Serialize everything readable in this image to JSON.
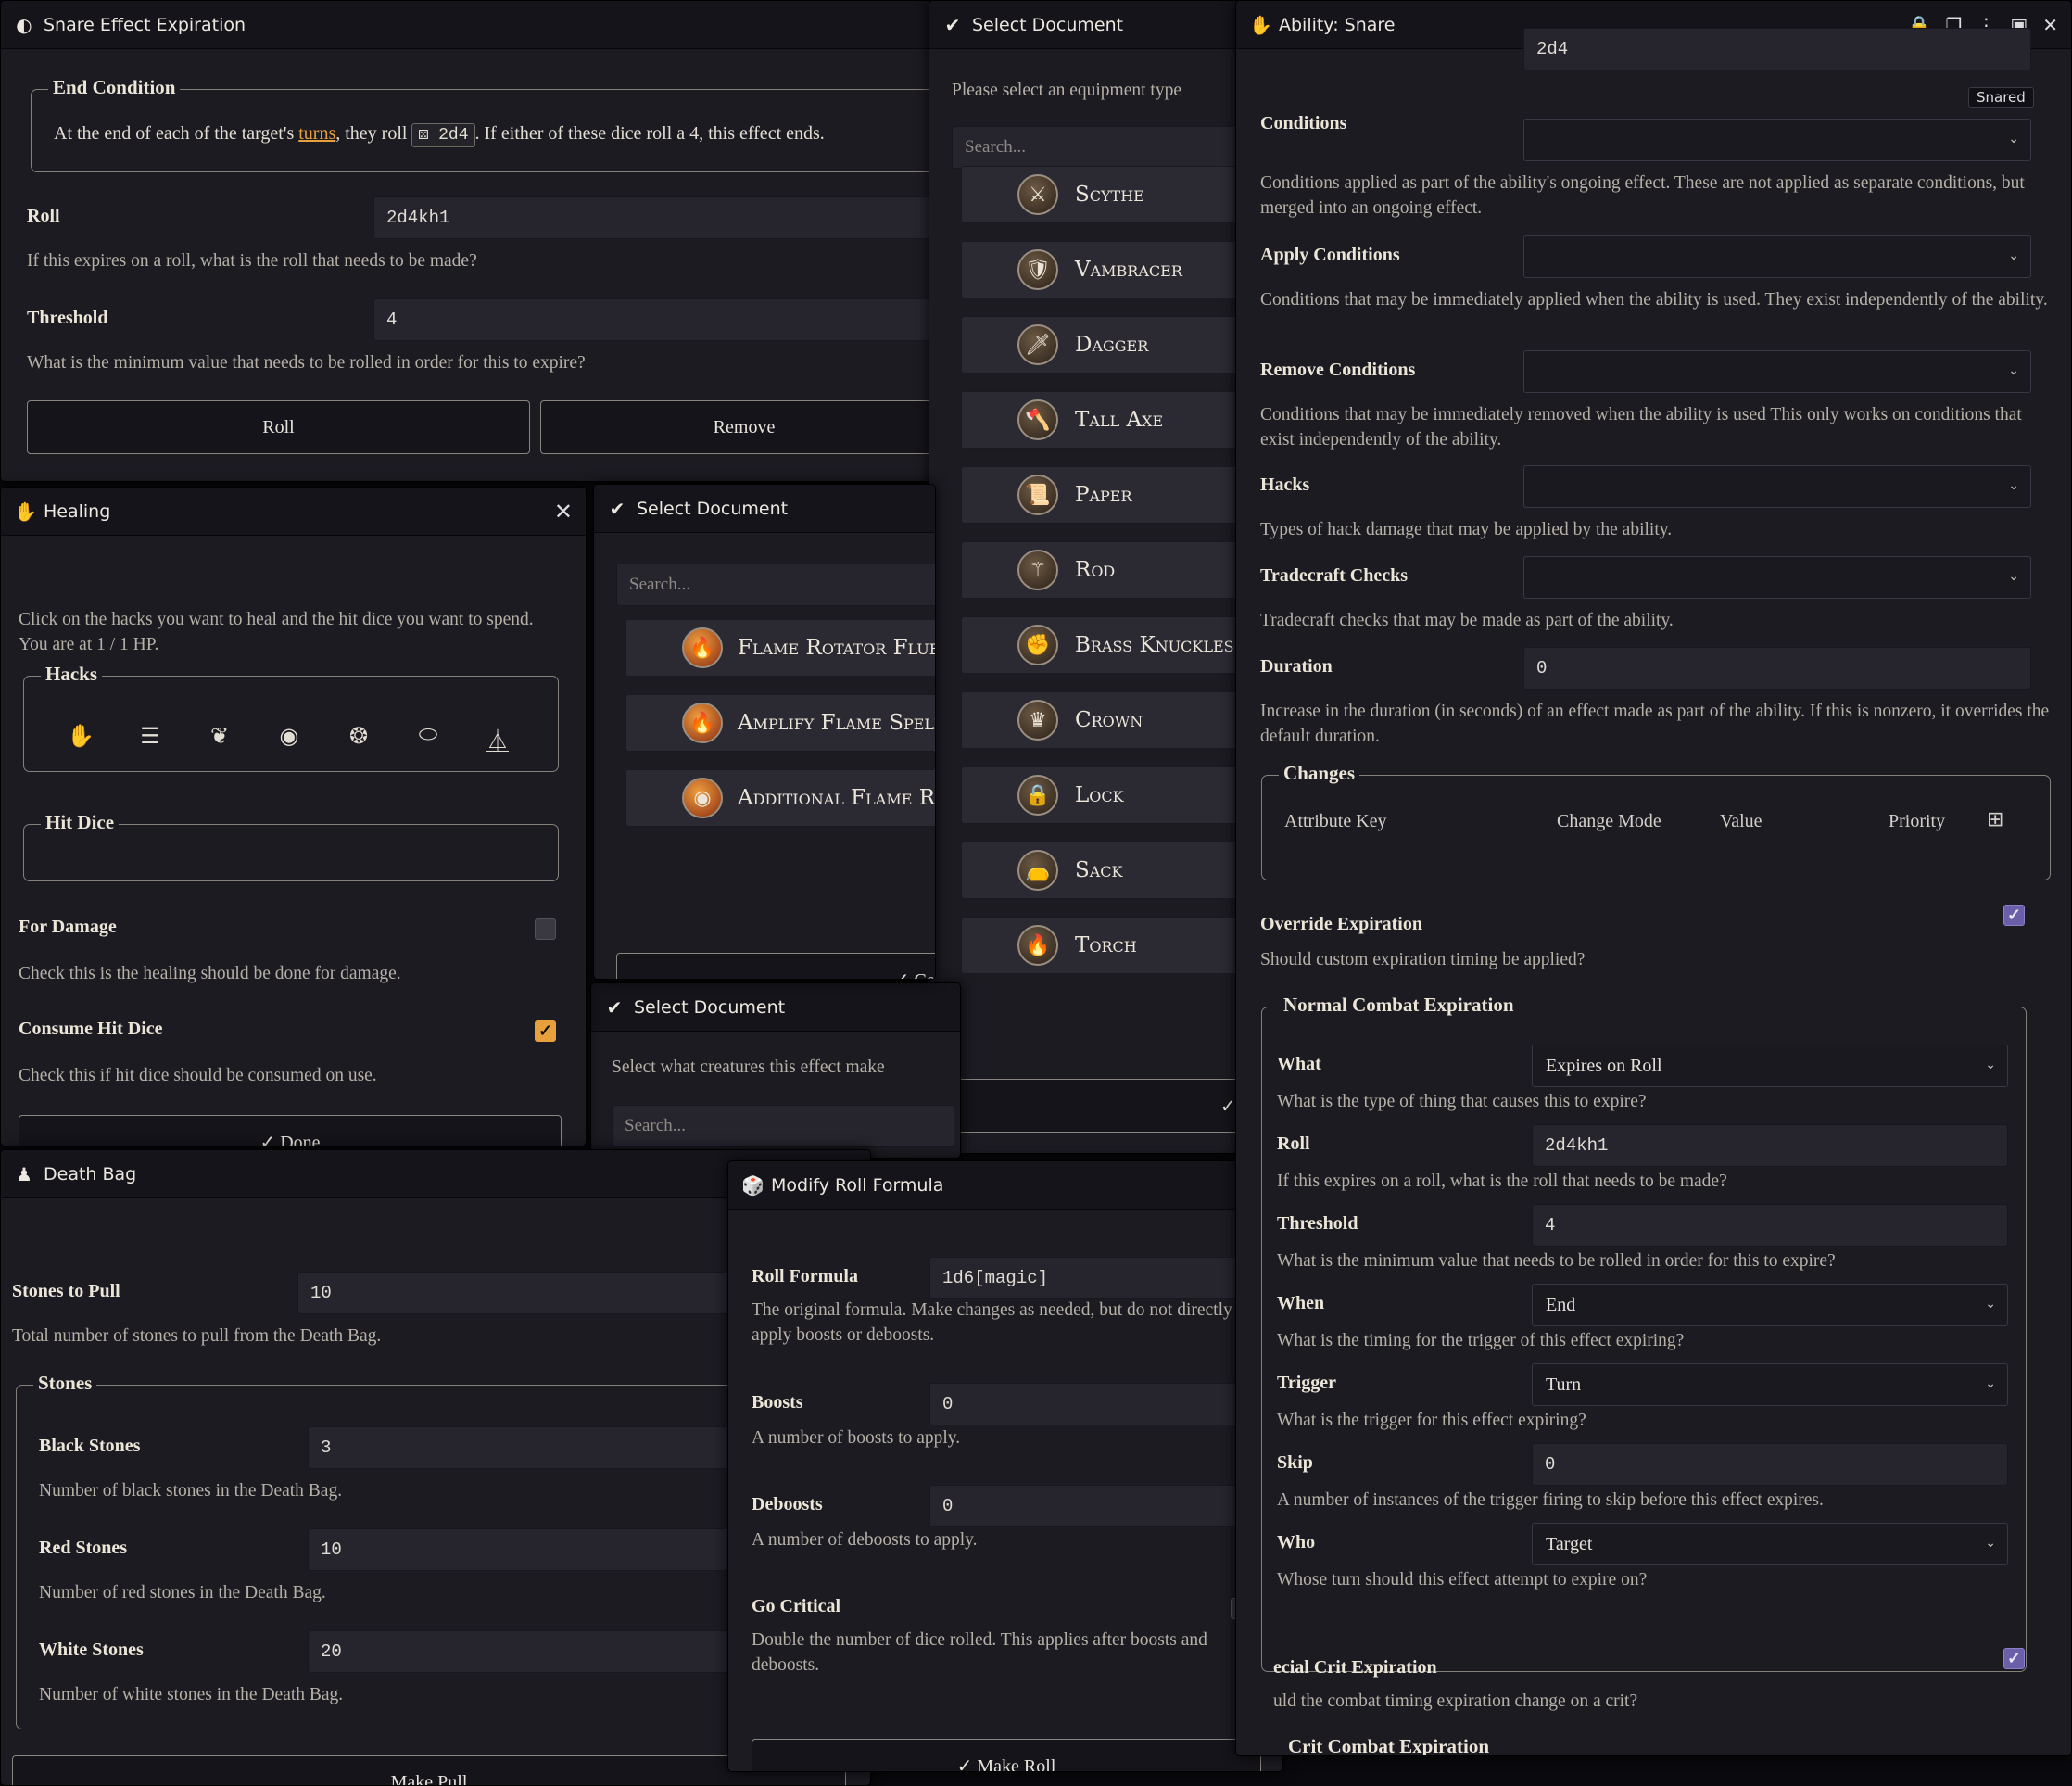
{
  "snare_win": {
    "title": "Snare Effect Expiration",
    "end_condition_legend": "End Condition",
    "end_text_pre": "At the end of each of the target's ",
    "end_text_link": "turns",
    "end_text_mid": ", they roll ",
    "end_text_dice": "2d4",
    "end_text_post": ". If either of these dice roll a 4, this effect ends.",
    "roll_label": "Roll",
    "roll_value": "2d4kh1",
    "roll_hint": "If this expires on a roll, what is the roll that needs to be made?",
    "threshold_label": "Threshold",
    "threshold_value": "4",
    "threshold_hint": "What is the minimum value that needs to be rolled in order for this to expire?",
    "roll_button": "Roll",
    "remove_button": "Remove"
  },
  "healing_win": {
    "title": "Healing",
    "intro": "Click on the hacks you want to heal and the hit dice you want to spend. You are at 1 / 1 HP.",
    "hacks_legend": "Hacks",
    "hit_dice_legend": "Hit Dice",
    "for_damage_label": "For Damage",
    "for_damage_hint": "Check this is the healing should be done for damage.",
    "consume_label": "Consume Hit Dice",
    "consume_hint": "Check this if hit dice should be consumed on use.",
    "done_button": "✓ Done"
  },
  "select_doc_1": {
    "title": "Select Document",
    "search_placeholder": "Search...",
    "items": [
      {
        "name": "Flame Rotator Fluency",
        "icon": "🔥"
      },
      {
        "name": "Amplify Flame Spells",
        "icon": "🔥"
      },
      {
        "name": "Additional Flame Rotators",
        "icon": "◉"
      }
    ],
    "confirm_button": "✓ Confi"
  },
  "select_doc_2": {
    "title": "Select Document",
    "prompt": "Select what creatures this effect make",
    "search_placeholder": "Search..."
  },
  "select_doc_equip": {
    "title": "Select Document",
    "prompt": "Please select an equipment type",
    "search_placeholder": "Search...",
    "items": [
      {
        "name": "Scythe",
        "icon": "⚔"
      },
      {
        "name": "Vambracer",
        "icon": "🛡"
      },
      {
        "name": "Dagger",
        "icon": "🗡"
      },
      {
        "name": "Tall Axe",
        "icon": "🪓"
      },
      {
        "name": "Paper",
        "icon": "📜"
      },
      {
        "name": "Rod",
        "icon": "⚚"
      },
      {
        "name": "Brass Knuckles",
        "icon": "✊"
      },
      {
        "name": "Crown",
        "icon": "♛"
      },
      {
        "name": "Lock",
        "icon": "🔒"
      },
      {
        "name": "Sack",
        "icon": "👝"
      },
      {
        "name": "Torch",
        "icon": "🔥"
      }
    ],
    "confirm_button": "✓ C"
  },
  "death_bag_win": {
    "title": "Death Bag",
    "stones_to_pull_label": "Stones to Pull",
    "stones_to_pull_value": "10",
    "stones_to_pull_hint": "Total number of stones to pull from the Death Bag.",
    "stones_legend": "Stones",
    "black_label": "Black Stones",
    "black_value": "3",
    "black_hint": "Number of black stones in the Death Bag.",
    "red_label": "Red Stones",
    "red_value": "10",
    "red_hint": "Number of red stones in the Death Bag.",
    "white_label": "White Stones",
    "white_value": "20",
    "white_hint": "Number of white stones in the Death Bag.",
    "make_pull_button": "Make Pull"
  },
  "modify_roll_win": {
    "title": "Modify Roll Formula",
    "formula_label": "Roll Formula",
    "formula_value": "1d6[magic]",
    "formula_hint": "The original formula. Make changes as needed, but do not directly apply boosts or deboosts.",
    "boosts_label": "Boosts",
    "boosts_value": "0",
    "boosts_hint": "A number of boosts to apply.",
    "deboosts_label": "Deboosts",
    "deboosts_value": "0",
    "deboosts_hint": "A number of deboosts to apply.",
    "go_critical_label": "Go Critical",
    "go_critical_hint": "Double the number of dice rolled. This applies after boosts and deboosts.",
    "make_roll_button": "✓ Make Roll"
  },
  "ability_win": {
    "title": "Ability: Snare",
    "top_input_fragment": "2d4",
    "badge": "Snared",
    "conditions_label": "Conditions",
    "conditions_hint": "Conditions applied as part of the ability's ongoing effect. These are not applied as separate conditions, but merged into an ongoing effect.",
    "apply_conditions_label": "Apply Conditions",
    "apply_conditions_hint": "Conditions that may be immediately applied when the ability is used. They exist independently of the ability.",
    "remove_conditions_label": "Remove Conditions",
    "remove_conditions_hint": "Conditions that may be immediately removed when the ability is used This only works on conditions that exist independently of the ability.",
    "hacks_label": "Hacks",
    "hacks_hint": "Types of hack damage that may be applied by the ability.",
    "tradecraft_label": "Tradecraft Checks",
    "tradecraft_hint": "Tradecraft checks that may be made as part of the ability.",
    "duration_label": "Duration",
    "duration_value": "0",
    "duration_hint": "Increase in the duration (in seconds) of an effect made as part of the ability. If this is nonzero, it overrides the default duration.",
    "changes_legend": "Changes",
    "changes_columns": [
      "Attribute Key",
      "Change Mode",
      "Value",
      "Priority"
    ],
    "override_label": "Override Expiration",
    "override_hint": "Should custom expiration timing be applied?",
    "normal_legend": "Normal Combat Expiration",
    "what_label": "What",
    "what_value": "Expires on Roll",
    "what_hint": "What is the type of thing that causes this to expire?",
    "roll_label": "Roll",
    "roll_value": "2d4kh1",
    "roll_hint": "If this expires on a roll, what is the roll that needs to be made?",
    "threshold_label": "Threshold",
    "threshold_value": "4",
    "threshold_hint": "What is the minimum value that needs to be rolled in order for this to expire?",
    "when_label": "When",
    "when_value": "End",
    "when_hint": "What is the timing for the trigger of this effect expiring?",
    "trigger_label": "Trigger",
    "trigger_value": "Turn",
    "trigger_hint": "What is the trigger for this effect expiring?",
    "skip_label": "Skip",
    "skip_value": "0",
    "skip_hint": "A number of instances of the trigger firing to skip before this effect expires.",
    "who_label": "Who",
    "who_value": "Target",
    "who_hint": "Whose turn should this effect attempt to expire on?",
    "special_crit_label": "ecial Crit Expiration",
    "special_crit_hint": "uld the combat timing expiration change on a crit?",
    "crit_legend": "Crit Combat Expiration"
  },
  "colors": {
    "accent": "#e8a03c",
    "panel": "#1c1b22",
    "check_purple": "#6a5fa8"
  }
}
